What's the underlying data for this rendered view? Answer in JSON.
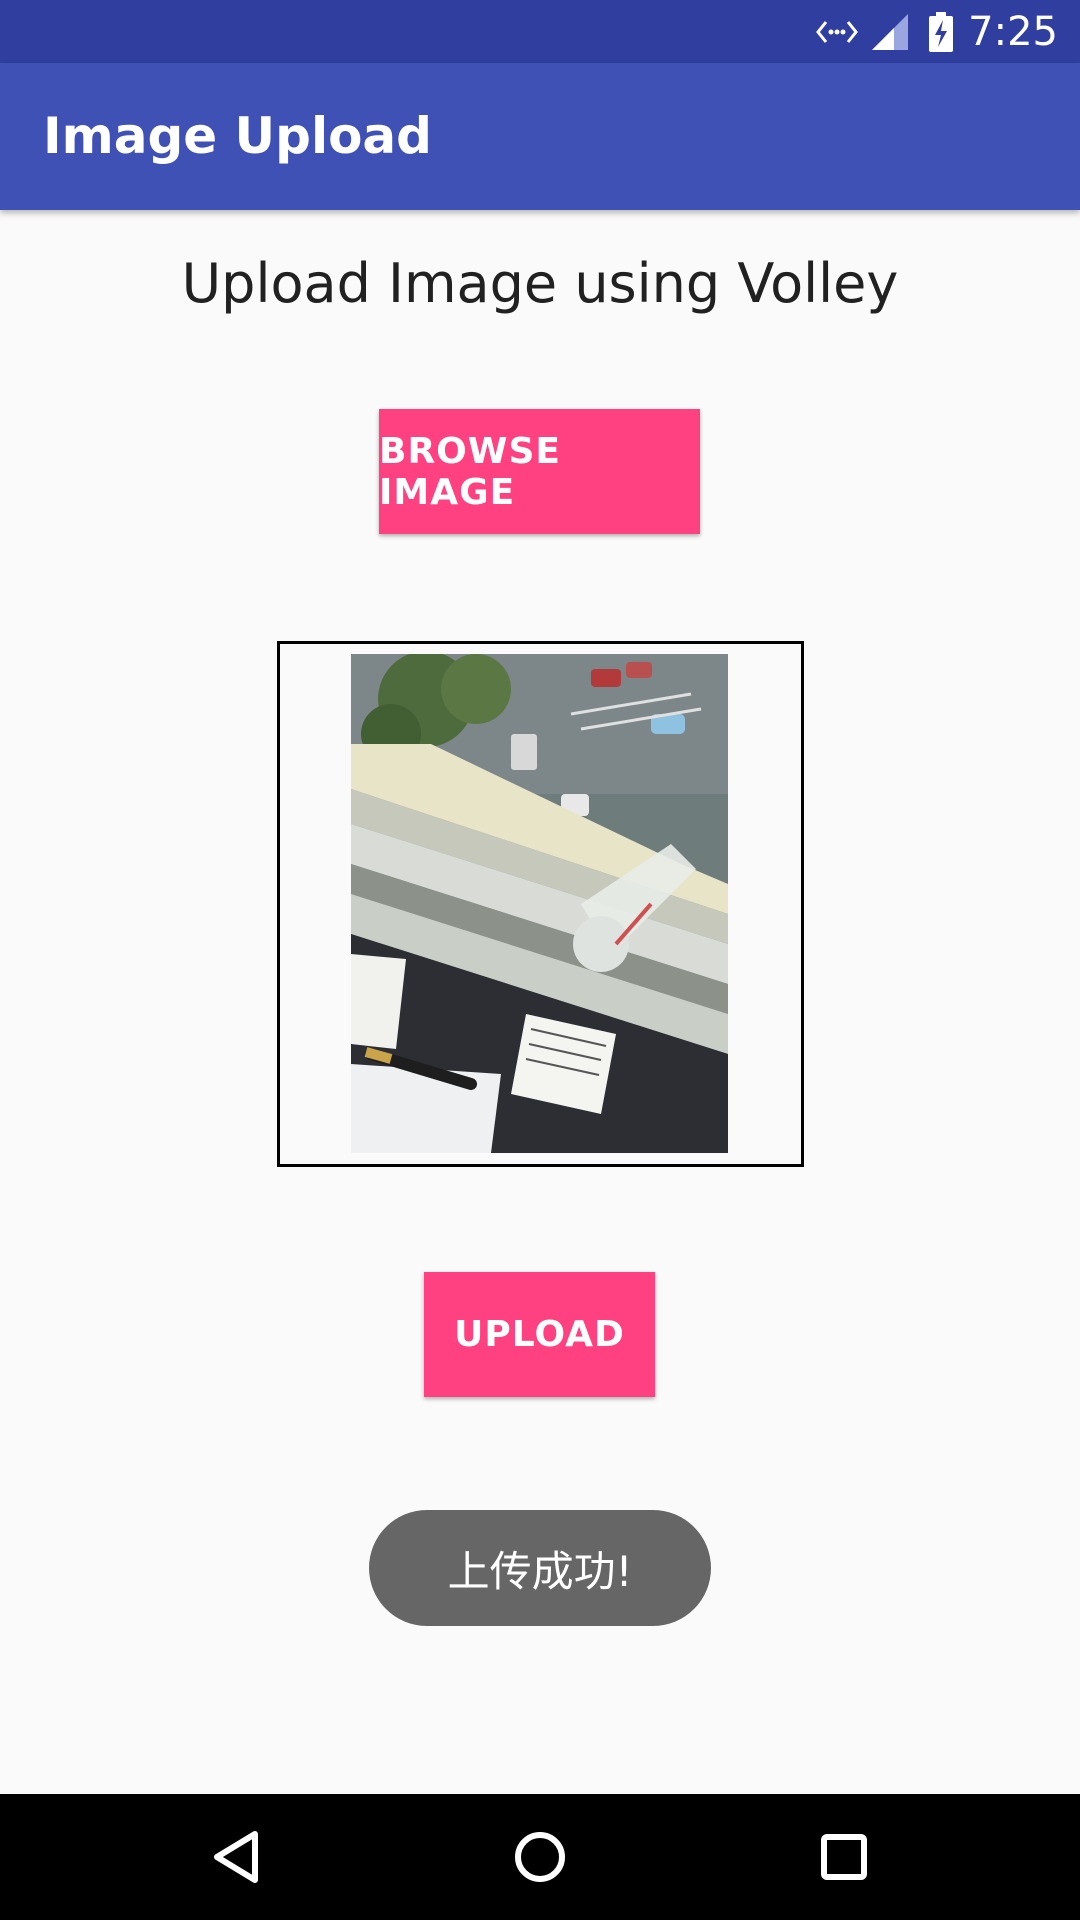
{
  "status_bar": {
    "time": "7:25",
    "icons": [
      "data-transfer-icon",
      "cell-signal-icon",
      "battery-charging-icon"
    ]
  },
  "app_bar": {
    "title": "Image Upload"
  },
  "main": {
    "heading": "Upload Image using Volley",
    "browse_button_label": "BROWSE IMAGE",
    "preview_image": "image-preview",
    "upload_button_label": "UPLOAD"
  },
  "toast": {
    "message": "上传成功!"
  },
  "nav_bar": {
    "icons": [
      "back-icon",
      "home-icon",
      "recents-icon"
    ]
  },
  "colors": {
    "status_bar": "#303f9f",
    "app_bar": "#3f51b5",
    "accent": "#ff4081",
    "background": "#fafafa",
    "toast": "#666666"
  }
}
